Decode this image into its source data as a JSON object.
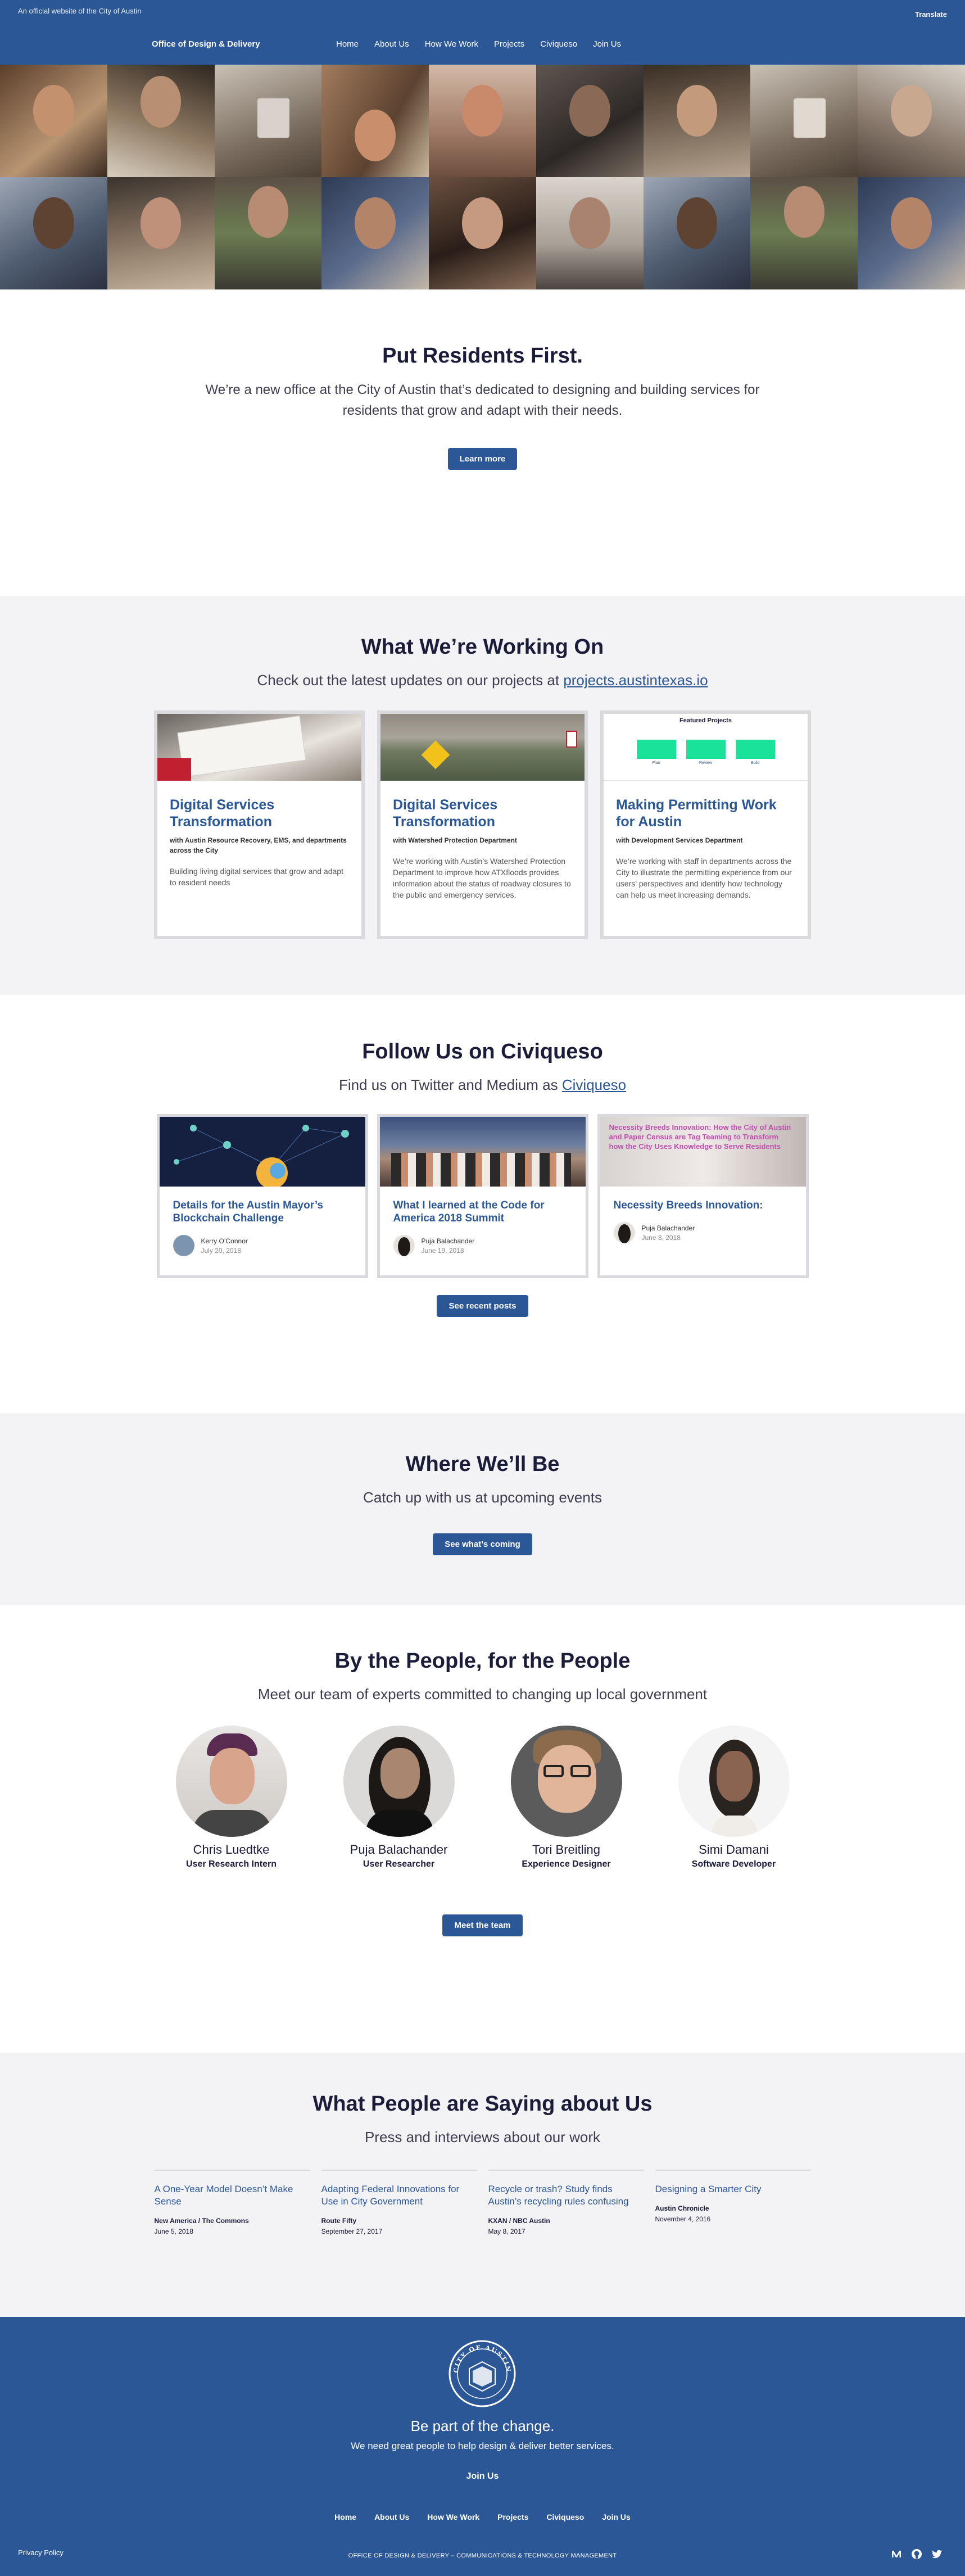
{
  "header": {
    "official": "An official website of the City of Austin",
    "translate": "Translate",
    "brand": "Office of Design & Delivery",
    "nav": [
      "Home",
      "About Us",
      "How We Work",
      "Projects",
      "Civiqueso",
      "Join Us"
    ]
  },
  "mission": {
    "title": "Put Residents First.",
    "text": "We’re a new office at the City of Austin that’s dedicated to designing and building services for residents that grow and adapt with their needs.",
    "button": "Learn more"
  },
  "projects": {
    "title": "What We’re Working On",
    "subtitle_prefix": "Check out the latest updates on our projects at ",
    "subtitle_link": "projects.austintexas.io",
    "cards": [
      {
        "title": "Digital Services Transformation",
        "partner": "with Austin Resource Recovery, EMS, and departments across the City",
        "desc": "Building living digital services that grow and adapt to resident needs"
      },
      {
        "title": "Digital Services Transformation",
        "partner": "with Watershed Protection Department",
        "desc": "We’re working with Austin’s Watershed Protection Department to improve how ATXfloods provides information about the status of roadway closures to the public and emergency services."
      },
      {
        "title": "Making Permitting Work for Austin",
        "partner": "with Development Services Department",
        "desc": "We’re working with staff in departments across the City to illustrate the permitting experience from our users’ perspectives and identify how technology can help us meet increasing demands.",
        "img_title": "Featured Projects",
        "img_labels": [
          "Plan",
          "Review",
          "Build"
        ]
      }
    ]
  },
  "follow": {
    "title": "Follow Us on Civiqueso",
    "subtitle_prefix": "Find us on Twitter and Medium as ",
    "subtitle_link": "Civiqueso",
    "posts": [
      {
        "title": "Details for the Austin Mayor’s Blockchain Challenge",
        "author": "Kerry O’Connor",
        "date": "July 20, 2018"
      },
      {
        "title": "What I learned at the Code for America 2018 Summit",
        "author": "Puja Balachander",
        "date": "June 19, 2018"
      },
      {
        "title": "Necessity Breeds Innovation:",
        "author": "Puja Balachander",
        "date": "June 8, 2018",
        "img_text": "Necessity Breeds Innovation: How the City of Austin and Paper Census are Tag Teaming to Transform how the City Uses Knowledge to Serve Residents"
      }
    ],
    "button": "See recent posts"
  },
  "events": {
    "title": "Where We’ll Be",
    "subtitle": "Catch up with us at upcoming events",
    "button": "See what’s coming"
  },
  "team": {
    "title": "By the People, for the People",
    "subtitle": "Meet our team of experts committed to changing up local government",
    "members": [
      {
        "name": "Chris Luedtke",
        "role": "User Research Intern"
      },
      {
        "name": "Puja Balachander",
        "role": "User Researcher"
      },
      {
        "name": "Tori Breitling",
        "role": "Experience Designer"
      },
      {
        "name": "Simi Damani",
        "role": "Software Developer"
      }
    ],
    "button": "Meet the team"
  },
  "press": {
    "title": "What People are Saying about Us",
    "subtitle": "Press and interviews about our work",
    "items": [
      {
        "title": "A One-Year Model Doesn’t Make Sense",
        "source": "New America / The Commons",
        "date": "June 5, 2018"
      },
      {
        "title": "Adapting Federal Innovations for Use in City Government",
        "source": "Route Fifty",
        "date": "September 27, 2017"
      },
      {
        "title": "Recycle or trash? Study finds Austin’s recycling rules confusing",
        "source": "KXAN / NBC Austin",
        "date": "May 8, 2017"
      },
      {
        "title": "Designing a Smarter City",
        "source": "Austin Chronicle",
        "date": "November 4, 2016"
      }
    ]
  },
  "footer": {
    "seal_text": "CITY OF AUSTIN",
    "cta": "Be part of the change.",
    "cta2": "We need great people to help design & deliver better services.",
    "join": "Join Us",
    "nav": [
      "Home",
      "About Us",
      "How We Work",
      "Projects",
      "Civiqueso",
      "Join Us"
    ],
    "privacy": "Privacy Policy",
    "credit": "OFFICE OF DESIGN & DELIVERY – COMMUNICATIONS & TECHNOLOGY MANAGEMENT",
    "social": [
      "medium-icon",
      "github-icon",
      "twitter-icon"
    ]
  }
}
